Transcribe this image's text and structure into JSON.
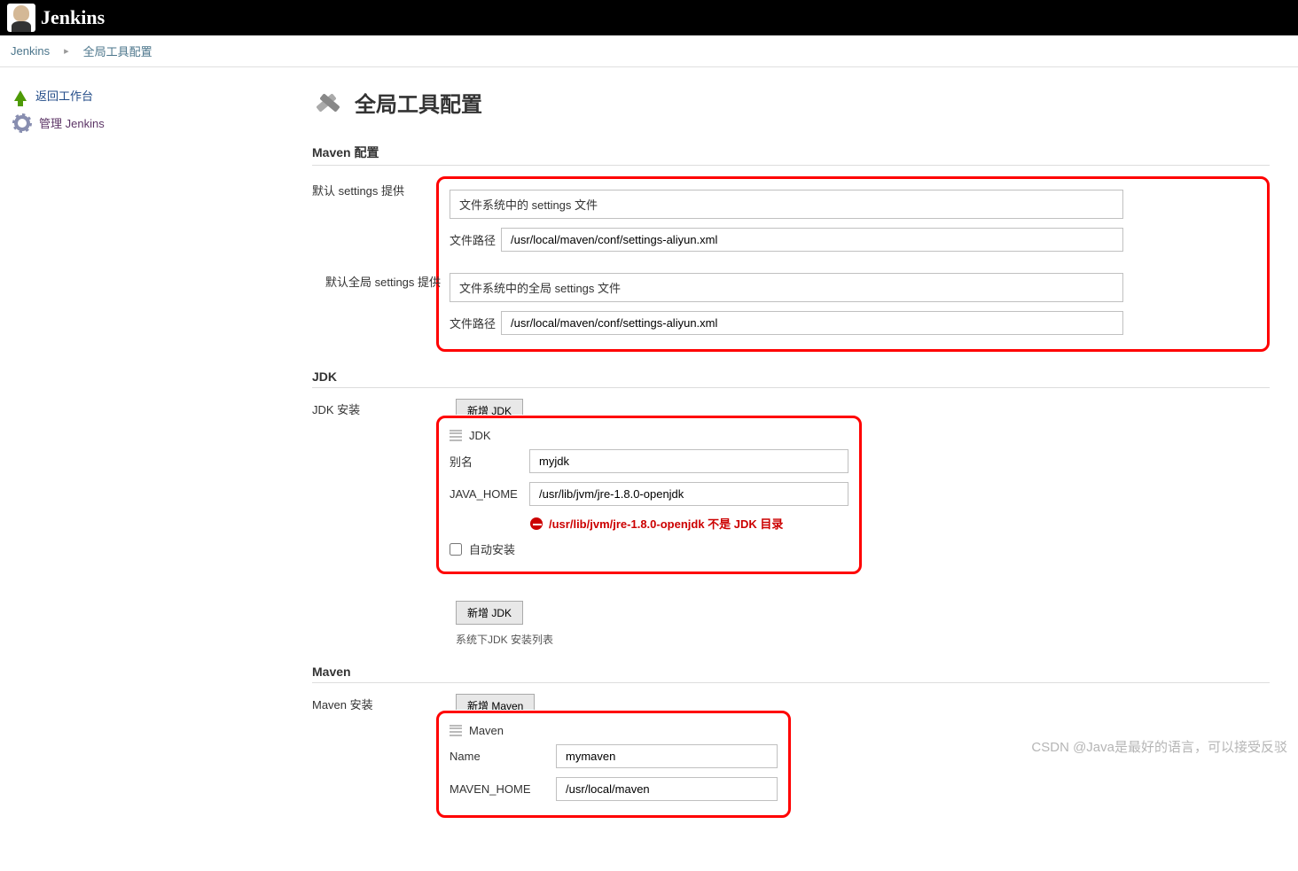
{
  "header": {
    "app_name": "Jenkins"
  },
  "breadcrumb": {
    "items": [
      "Jenkins",
      "全局工具配置"
    ]
  },
  "sidebar": {
    "items": [
      {
        "label": "返回工作台"
      },
      {
        "label": "管理 Jenkins"
      }
    ]
  },
  "page": {
    "title": "全局工具配置"
  },
  "maven_config": {
    "section_title": "Maven 配置",
    "default_settings_label": "默认 settings 提供",
    "default_settings_select": "文件系统中的 settings 文件",
    "file_path_label": "文件路径",
    "default_settings_path": "/usr/local/maven/conf/settings-aliyun.xml",
    "default_global_settings_label": "默认全局 settings 提供",
    "default_global_settings_select": "文件系统中的全局 settings 文件",
    "default_global_settings_path": "/usr/local/maven/conf/settings-aliyun.xml"
  },
  "jdk": {
    "section_title": "JDK",
    "install_label": "JDK 安装",
    "add_button_truncated": "新增 JDK",
    "item_title": "JDK",
    "name_label": "别名",
    "name_value": "myjdk",
    "home_label": "JAVA_HOME",
    "home_value": "/usr/lib/jvm/jre-1.8.0-openjdk",
    "error_message": "/usr/lib/jvm/jre-1.8.0-openjdk 不是 JDK 目录",
    "auto_install_label": "自动安装",
    "auto_install_checked": false,
    "add_button": "新增 JDK",
    "help_text": "系统下JDK 安装列表"
  },
  "maven_install": {
    "section_title": "Maven",
    "install_label": "Maven 安装",
    "add_button_truncated": "新增 Maven",
    "item_title": "Maven",
    "name_label": "Name",
    "name_value": "mymaven",
    "home_label": "MAVEN_HOME",
    "home_value": "/usr/local/maven"
  },
  "watermark": "CSDN @Java是最好的语言，可以接受反驳"
}
